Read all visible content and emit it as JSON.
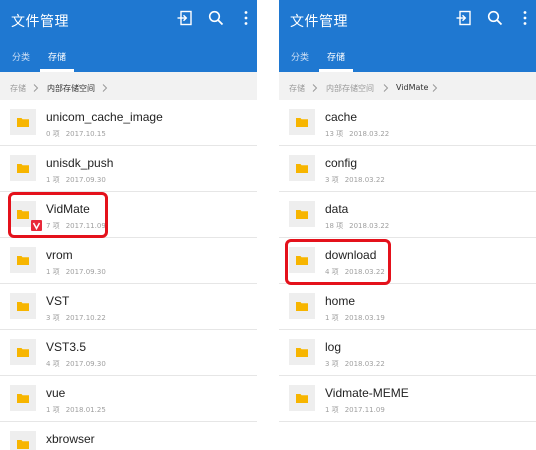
{
  "left": {
    "app_title": "文件管理",
    "tabs": [
      {
        "label": "分类"
      },
      {
        "label": "存储"
      }
    ],
    "breadcrumb": [
      "存储",
      "内部存储空间"
    ],
    "items": [
      {
        "name": "unicom_cache_image",
        "count": "0 项",
        "date": "2017.10.15"
      },
      {
        "name": "unisdk_push",
        "count": "1 项",
        "date": "2017.09.30"
      },
      {
        "name": "VidMate",
        "count": "7 项",
        "date": "2017.11.09"
      },
      {
        "name": "vrom",
        "count": "1 项",
        "date": "2017.09.30"
      },
      {
        "name": "VST",
        "count": "3 项",
        "date": "2017.10.22"
      },
      {
        "name": "VST3.5",
        "count": "4 项",
        "date": "2017.09.30"
      },
      {
        "name": "vue",
        "count": "1 项",
        "date": "2018.01.25"
      },
      {
        "name": "xbrowser",
        "count": "",
        "date": ""
      }
    ]
  },
  "right": {
    "app_title": "文件管理",
    "tabs": [
      {
        "label": "分类"
      },
      {
        "label": "存储"
      }
    ],
    "breadcrumb": [
      "存储",
      "内部存储空间",
      "VidMate"
    ],
    "items": [
      {
        "name": "cache",
        "count": "13 项",
        "date": "2018.03.22"
      },
      {
        "name": "config",
        "count": "3 项",
        "date": "2018.03.22"
      },
      {
        "name": "data",
        "count": "18 项",
        "date": "2018.03.22"
      },
      {
        "name": "download",
        "count": "4 项",
        "date": "2018.03.22"
      },
      {
        "name": "home",
        "count": "1 项",
        "date": "2018.03.19"
      },
      {
        "name": "log",
        "count": "3 项",
        "date": "2018.03.22"
      },
      {
        "name": "Vidmate-MEME",
        "count": "1 项",
        "date": "2017.11.09"
      }
    ]
  },
  "icons": {
    "toolbar": [
      "export-icon",
      "search-icon",
      "more-vert-icon"
    ],
    "folder": "folder-icon",
    "app_badge": "vidmate-badge-icon"
  },
  "colors": {
    "app_bar": "#1f78d1",
    "folder": "#f7b500",
    "highlight": "#e4111b",
    "badge": "#e8293a"
  }
}
